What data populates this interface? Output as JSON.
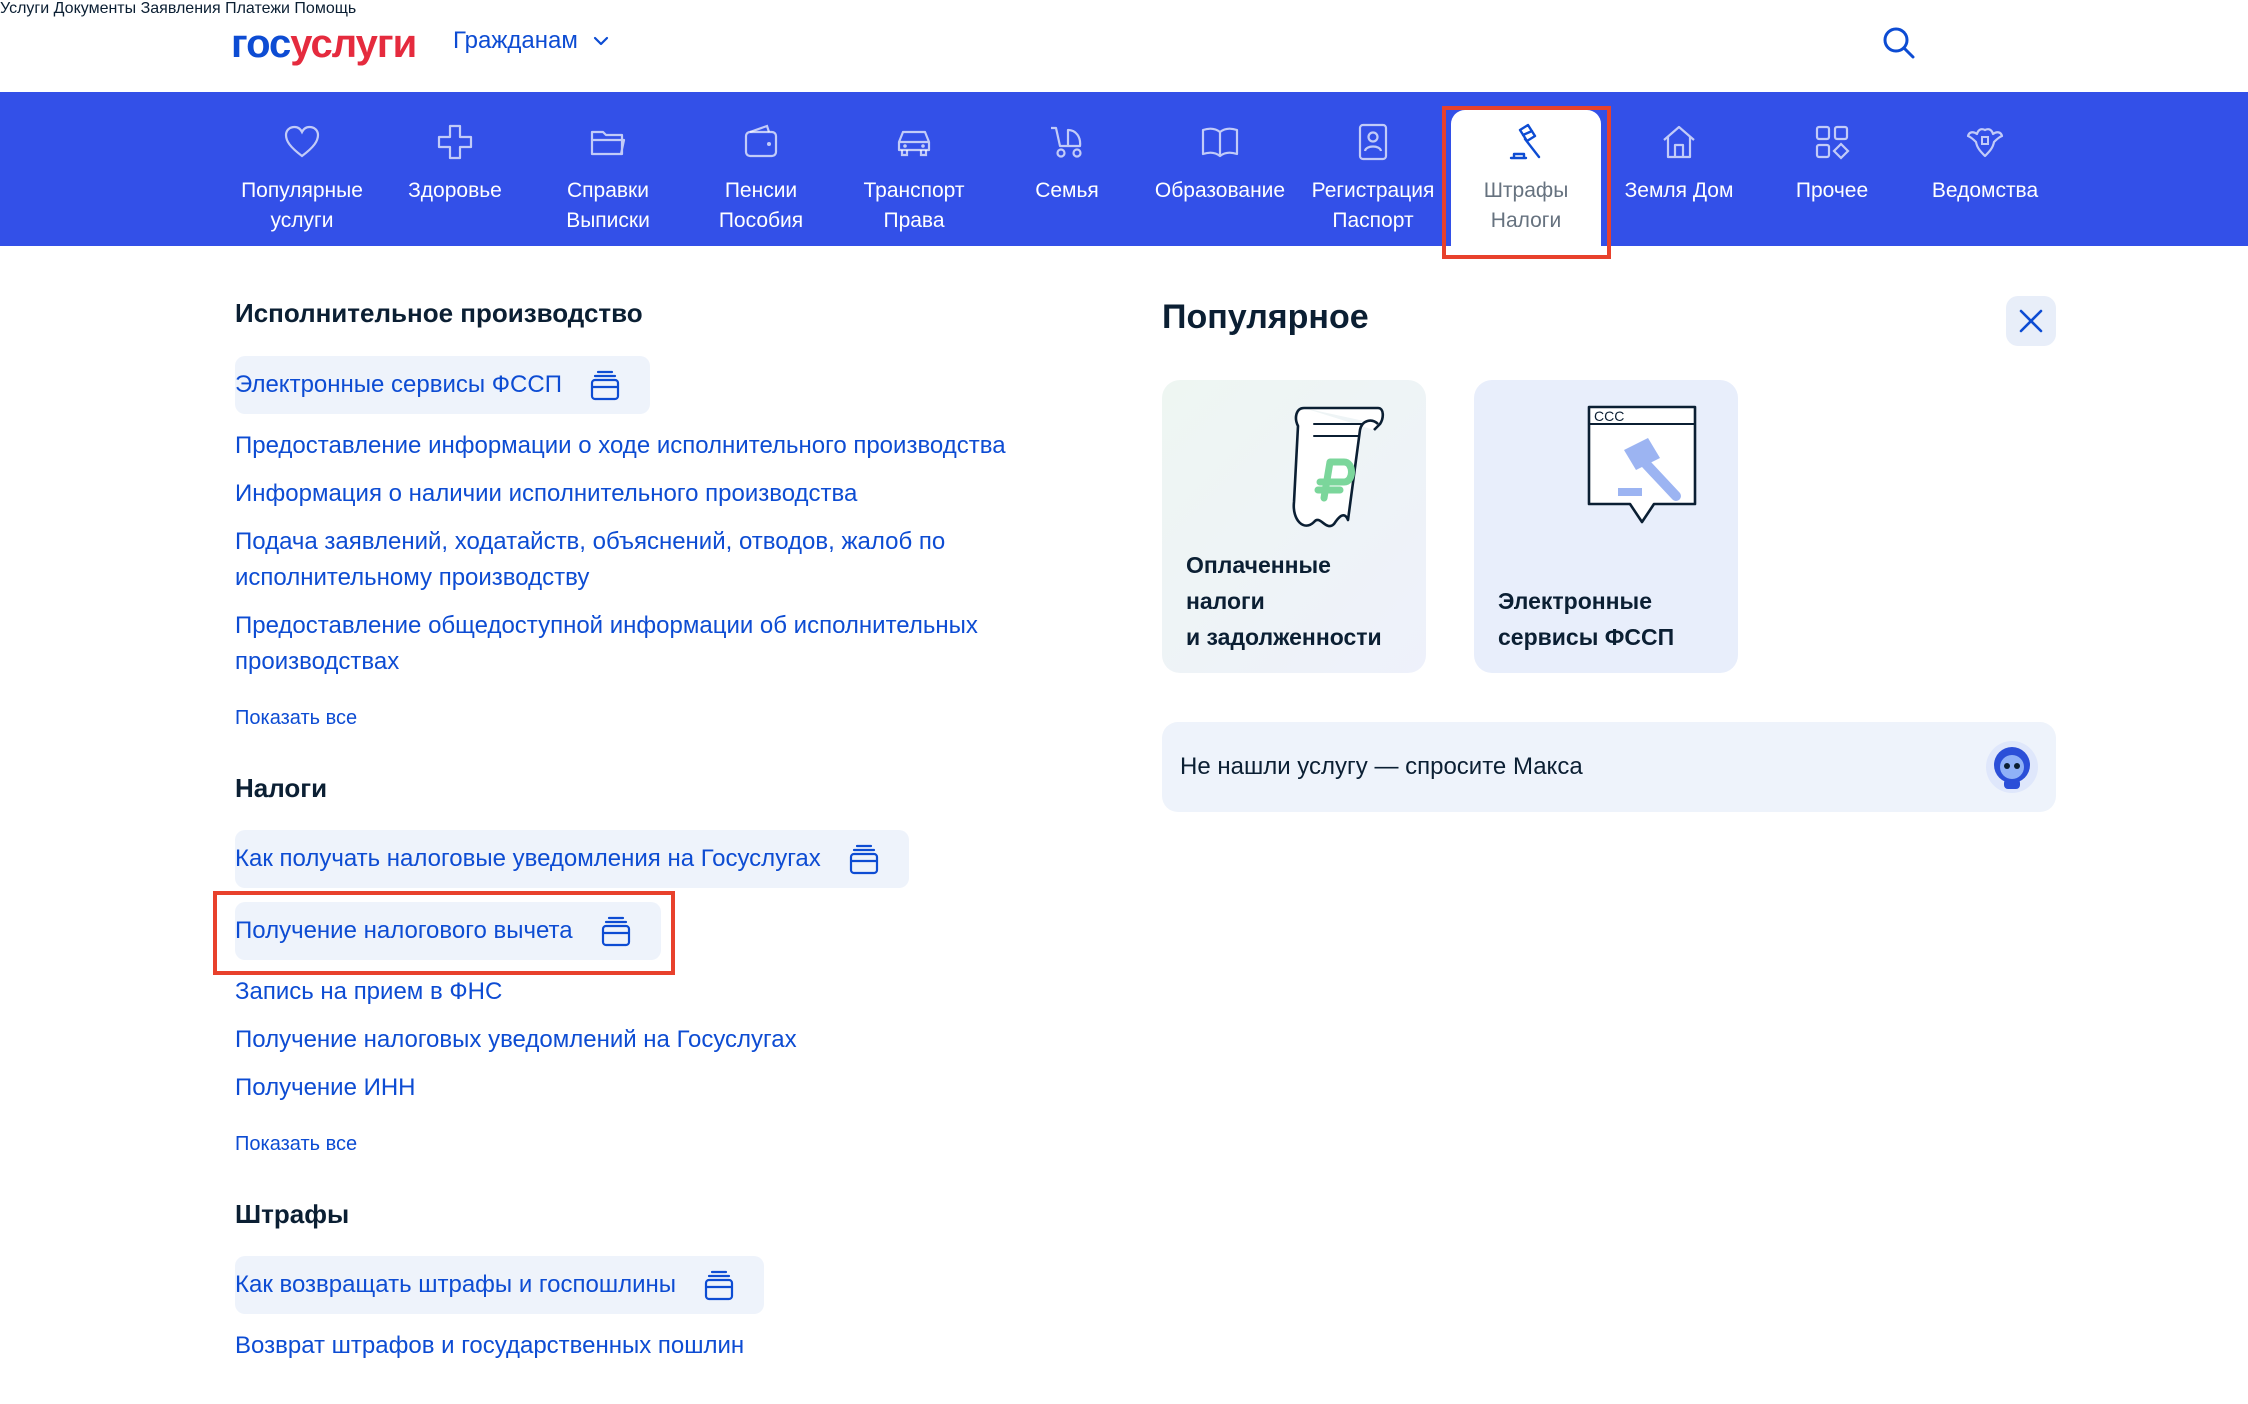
{
  "header": {
    "logo": {
      "part1": "гос",
      "part2": "услуги"
    },
    "audience_label": "Гражданам",
    "nav": [
      "Услуги",
      "Документы",
      "Заявления",
      "Платежи",
      "Помощь"
    ]
  },
  "categories": [
    {
      "label": "Популярные\nуслуги",
      "icon": "heart-icon"
    },
    {
      "label": "Здоровье",
      "icon": "plus-cross-icon"
    },
    {
      "label": "Справки\nВыписки",
      "icon": "folder-icon"
    },
    {
      "label": "Пенсии\nПособия",
      "icon": "wallet-icon"
    },
    {
      "label": "Транспорт\nПрава",
      "icon": "car-icon"
    },
    {
      "label": "Семья",
      "icon": "stroller-icon"
    },
    {
      "label": "Образование",
      "icon": "book-icon"
    },
    {
      "label": "Регистрация\nПаспорт",
      "icon": "id-card-icon"
    },
    {
      "label": "Штрафы\nНалоги",
      "icon": "gavel-icon",
      "active": true
    },
    {
      "label": "Земля Дом",
      "icon": "house-icon"
    },
    {
      "label": "Прочее",
      "icon": "grid-icon"
    },
    {
      "label": "Ведомства",
      "icon": "emblem-icon"
    }
  ],
  "sections": {
    "enforcement": {
      "title": "Исполнительное производство",
      "pill": "Электронные сервисы ФССП",
      "links": [
        "Предоставление информации о ходе исполнительного производства",
        "Информация о наличии исполнительного производства",
        "Подача заявлений, ходатайств, объяснений, отводов, жалоб по исполнительному производству",
        "Предоставление общедоступной информации об исполнительных производствах"
      ],
      "show_all": "Показать все"
    },
    "taxes": {
      "title": "Налоги",
      "pills": [
        "Как получать налоговые уведомления на Госуслугах",
        "Получение налогового вычета"
      ],
      "links": [
        "Запись на прием в ФНС",
        "Получение налоговых уведомлений на Госуслугах",
        "Получение ИНН"
      ],
      "show_all": "Показать все"
    },
    "fines": {
      "title": "Штрафы",
      "pill": "Как возвращать штрафы и госпошлины",
      "links": [
        "Возврат штрафов и государственных пошлин"
      ]
    }
  },
  "popular": {
    "title": "Популярное",
    "cards": [
      {
        "text": "Оплаченные\nналоги\nи задолженности"
      },
      {
        "text": "Электронные\nсервисы ФССП"
      }
    ],
    "ask": "Не нашли услугу — спросите Макса"
  },
  "colors": {
    "brand_blue": "#0d4cd3",
    "bar_blue": "#3350e8",
    "brand_red": "#e52b3e",
    "highlight": "#e8412c"
  }
}
